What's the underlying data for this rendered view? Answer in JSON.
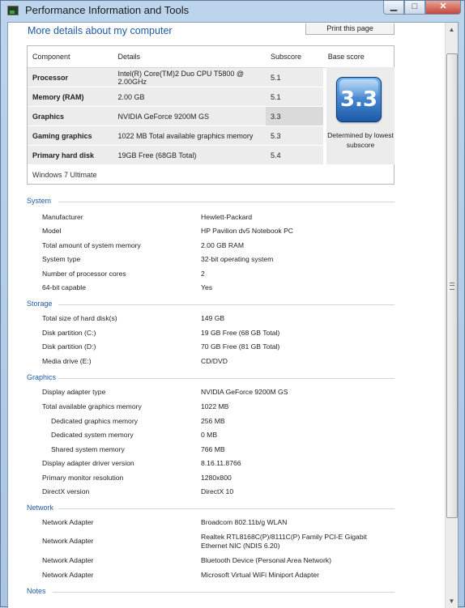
{
  "window": {
    "title": "Performance Information and Tools"
  },
  "header": {
    "heading": "More details about my computer",
    "print_label": "Print this page"
  },
  "scores": {
    "columns": [
      "Component",
      "Details",
      "Subscore",
      "Base score"
    ],
    "rows": [
      {
        "component": "Processor",
        "details": "Intel(R) Core(TM)2 Duo CPU T5800 @ 2.00GHz",
        "subscore": "5.1"
      },
      {
        "component": "Memory (RAM)",
        "details": "2.00 GB",
        "subscore": "5.1"
      },
      {
        "component": "Graphics",
        "details": "NVIDIA GeForce 9200M GS",
        "subscore": "3.3"
      },
      {
        "component": "Gaming graphics",
        "details": "1022 MB Total available graphics memory",
        "subscore": "5.3"
      },
      {
        "component": "Primary hard disk",
        "details": "19GB Free (68GB Total)",
        "subscore": "5.4"
      }
    ],
    "base_score": "3.3",
    "base_note": "Determined by lowest subscore",
    "edition": "Windows 7 Ultimate"
  },
  "sections": {
    "system": {
      "title": "System",
      "rows": [
        {
          "label": "Manufacturer",
          "value": "Hewlett-Packard"
        },
        {
          "label": "Model",
          "value": "HP Pavilion dv5 Notebook PC"
        },
        {
          "label": "Total amount of system memory",
          "value": "2.00 GB RAM"
        },
        {
          "label": "System type",
          "value": "32-bit operating system"
        },
        {
          "label": "Number of processor cores",
          "value": "2"
        },
        {
          "label": "64-bit capable",
          "value": "Yes"
        }
      ]
    },
    "storage": {
      "title": "Storage",
      "rows": [
        {
          "label": "Total size of hard disk(s)",
          "value": "149 GB"
        },
        {
          "label": "Disk partition (C:)",
          "value": "19 GB Free (68 GB Total)"
        },
        {
          "label": "Disk partition (D:)",
          "value": "70 GB Free (81 GB Total)"
        },
        {
          "label": "Media drive (E:)",
          "value": "CD/DVD"
        }
      ]
    },
    "graphics": {
      "title": "Graphics",
      "rows": [
        {
          "label": "Display adapter type",
          "value": "NVIDIA GeForce 9200M GS"
        },
        {
          "label": "Total available graphics memory",
          "value": "1022 MB"
        },
        {
          "label": "Dedicated graphics memory",
          "value": "256 MB"
        },
        {
          "label": "Dedicated system memory",
          "value": "0 MB"
        },
        {
          "label": "Shared system memory",
          "value": "766 MB"
        },
        {
          "label": "Display adapter driver version",
          "value": "8.16.11.8766"
        },
        {
          "label": "Primary monitor resolution",
          "value": "1280x800"
        },
        {
          "label": "DirectX version",
          "value": "DirectX 10"
        }
      ]
    },
    "network": {
      "title": "Network",
      "rows": [
        {
          "label": "Network Adapter",
          "value": "Broadcom 802.11b/g WLAN"
        },
        {
          "label": "Network Adapter",
          "value": "Realtek RTL8168C(P)/8111C(P) Family PCI-E Gigabit",
          "value2": "Ethernet NIC (NDIS 6.20)"
        },
        {
          "label": "Network Adapter",
          "value": "Bluetooth Device (Personal Area Network)"
        },
        {
          "label": "Network Adapter",
          "value": "Microsoft Virtual WiFi Miniport Adapter"
        }
      ]
    },
    "notes": {
      "title": "Notes"
    }
  }
}
